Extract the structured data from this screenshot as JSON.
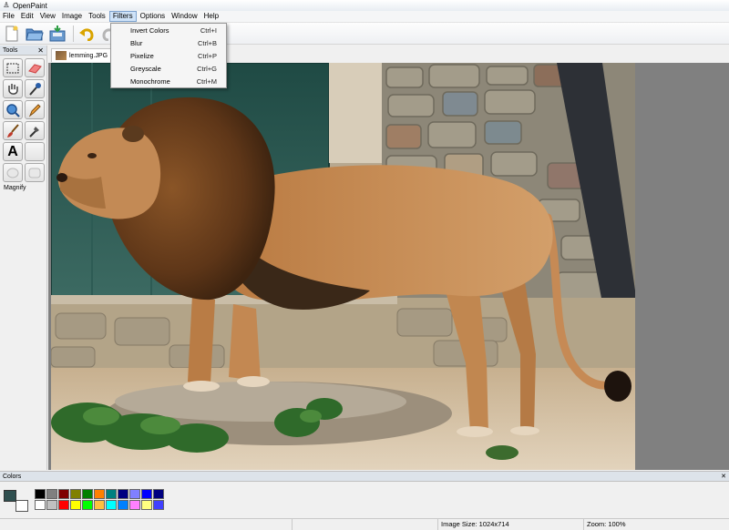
{
  "window": {
    "title": "OpenPaint"
  },
  "menubar": {
    "items": [
      "File",
      "Edit",
      "View",
      "Image",
      "Tools",
      "Filters",
      "Options",
      "Window",
      "Help"
    ],
    "active": "Filters"
  },
  "toolbar": {
    "buttons": [
      "new-icon",
      "open-icon",
      "save-icon",
      "undo-icon",
      "redo-icon"
    ]
  },
  "tools_panel": {
    "title": "Tools",
    "close": "✕",
    "selected_tool": "Magnify",
    "text_tool_glyph": "A"
  },
  "document": {
    "tab_label": "lemming.JPG"
  },
  "filters_menu": {
    "items": [
      {
        "label": "Invert Colors",
        "shortcut": "Ctrl+I"
      },
      {
        "label": "Blur",
        "shortcut": "Ctrl+B"
      },
      {
        "label": "Pixelize",
        "shortcut": "Ctrl+P"
      },
      {
        "label": "Greyscale",
        "shortcut": "Ctrl+G"
      },
      {
        "label": "Monochrome",
        "shortcut": "Ctrl+M"
      }
    ]
  },
  "colors_panel": {
    "title": "Colors",
    "close": "✕",
    "foreground": "#2f4f4f",
    "background": "#ffffff",
    "palette": [
      "#000000",
      "#808080",
      "#800000",
      "#808000",
      "#008000",
      "#ff8000",
      "#008080",
      "#000080",
      "#8080ff",
      "#0000ff",
      "#000080",
      "#ffffff",
      "#c0c0c0",
      "#ff0000",
      "#ffff00",
      "#00ff00",
      "#ffc040",
      "#00ffff",
      "#0080ff",
      "#ff80ff",
      "#ffff80",
      "#4040ff"
    ]
  },
  "statusbar": {
    "image_size": "Image Size: 1024x714",
    "zoom": "Zoom: 100%"
  }
}
